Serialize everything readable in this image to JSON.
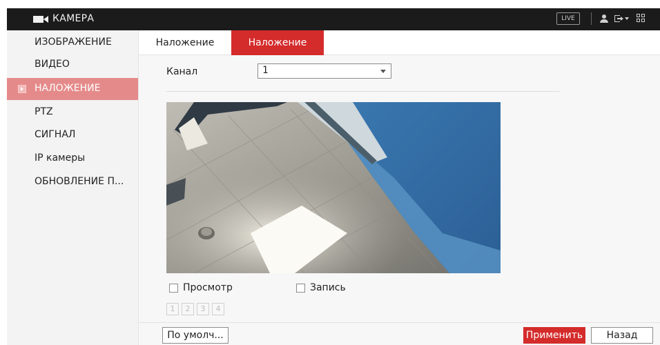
{
  "header": {
    "app_icon": "camera-icon",
    "title": "КАМЕРА",
    "live_label": "LIVE",
    "icons": [
      "user-icon",
      "logout-icon",
      "chevron-down-icon",
      "qr-code-icon"
    ]
  },
  "sidebar": {
    "items": [
      {
        "label": "ИЗОБРАЖЕНИЕ",
        "active": false
      },
      {
        "label": "ВИДЕО",
        "active": false
      },
      {
        "label": "НАЛОЖЕНИЕ",
        "active": true
      },
      {
        "label": "PTZ",
        "active": false
      },
      {
        "label": "СИГНАЛ",
        "active": false
      },
      {
        "label": "IP камеры",
        "active": false
      },
      {
        "label": "ОБНОВЛЕНИЕ П...",
        "active": false
      }
    ]
  },
  "main": {
    "tabs": [
      {
        "label": "Наложение",
        "active": false
      },
      {
        "label": "Наложение",
        "active": true
      }
    ],
    "channel": {
      "label": "Канал",
      "value": "1"
    },
    "checkboxes": [
      {
        "label": "Просмотр",
        "checked": false
      },
      {
        "label": "Запись",
        "checked": false
      }
    ],
    "regions": [
      "1",
      "2",
      "3",
      "4"
    ]
  },
  "footer": {
    "default_label": "По умолч...",
    "apply_label": "Применить",
    "back_label": "Назад"
  },
  "colors": {
    "accent": "#d42b2b",
    "sidebar_active": "#e58a8a",
    "topbar": "#1b1b1b"
  }
}
